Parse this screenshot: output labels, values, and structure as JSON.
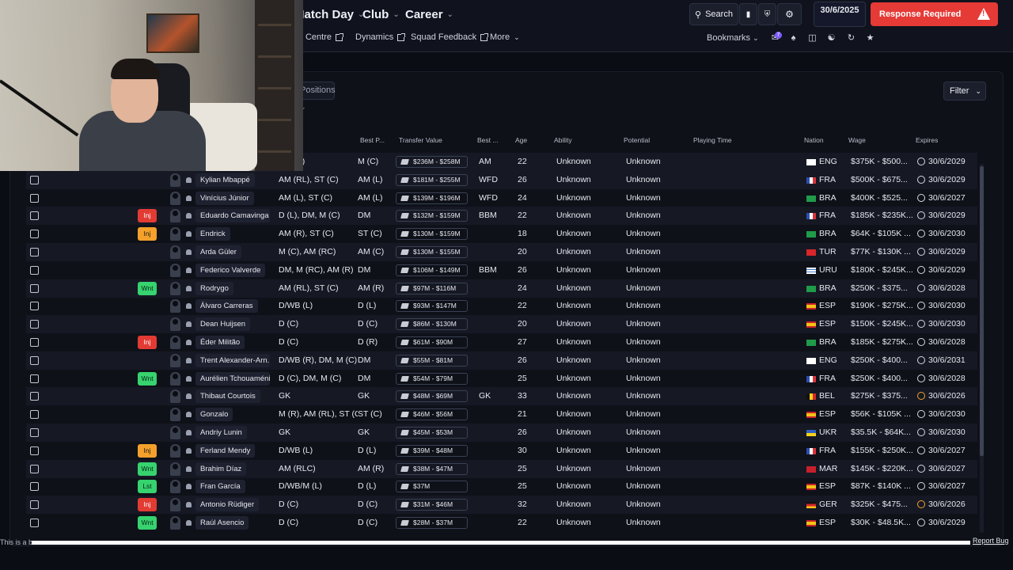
{
  "nav": {
    "main": [
      {
        "label": "Match Day"
      },
      {
        "label": "Club"
      },
      {
        "label": "Career"
      }
    ],
    "sub": [
      {
        "label": "Medical Centre"
      },
      {
        "label": "Dynamics"
      },
      {
        "label": "Squad Feedback"
      }
    ],
    "more": "More",
    "search": "Search",
    "date": "30/6/2025",
    "response": "Response Required",
    "bookmarks": "Bookmarks",
    "badge_count": "7"
  },
  "toolbar": {
    "view_label": "Positions",
    "filter": "Filter"
  },
  "table": {
    "columns": {
      "best_pos": "Best P...",
      "transfer_value": "Transfer Value",
      "best_role": "Best ...",
      "age": "Age",
      "ability": "Ability",
      "potential": "Potential",
      "playing_time": "Playing Time",
      "nation": "Nation",
      "wage": "Wage",
      "expires": "Expires"
    },
    "rows": [
      {
        "name": "",
        "position": "AM (C)",
        "best_pos": "M (C)",
        "tv": "$236M - $258M",
        "role": "AM",
        "age": "22",
        "ability": "Unknown",
        "potential": "Unknown",
        "nation": "ENG",
        "wage": "$375K - $500...",
        "expires": "30/6/2029",
        "tag": "",
        "flag": "eng",
        "clock": "normal"
      },
      {
        "name": "Kylian Mbappé",
        "position": "AM (RL), ST (C)",
        "best_pos": "AM (L)",
        "tv": "$181M - $255M",
        "role": "WFD",
        "age": "26",
        "ability": "Unknown",
        "potential": "Unknown",
        "nation": "FRA",
        "wage": "$500K - $675...",
        "expires": "30/6/2029",
        "tag": "",
        "flag": "fra",
        "clock": "normal"
      },
      {
        "name": "Vinícius Júnior",
        "position": "AM (L), ST (C)",
        "best_pos": "AM (L)",
        "tv": "$139M - $196M",
        "role": "WFD",
        "age": "24",
        "ability": "Unknown",
        "potential": "Unknown",
        "nation": "BRA",
        "wage": "$400K - $525...",
        "expires": "30/6/2027",
        "tag": "",
        "flag": "bra",
        "clock": "normal"
      },
      {
        "name": "Eduardo Camavinga",
        "position": "D (L), DM, M (C)",
        "best_pos": "DM",
        "tv": "$132M - $159M",
        "role": "BBM",
        "age": "22",
        "ability": "Unknown",
        "potential": "Unknown",
        "nation": "FRA",
        "wage": "$185K - $235K...",
        "expires": "30/6/2029",
        "tag": "Inj",
        "tagc": "inj-red",
        "flag": "fra",
        "clock": "normal"
      },
      {
        "name": "Endrick",
        "position": "AM (R), ST (C)",
        "best_pos": "ST (C)",
        "tv": "$130M - $159M",
        "role": "",
        "age": "18",
        "ability": "Unknown",
        "potential": "Unknown",
        "nation": "BRA",
        "wage": "$64K - $105K ...",
        "expires": "30/6/2030",
        "tag": "Inj",
        "tagc": "inj-amber",
        "flag": "bra",
        "clock": "normal"
      },
      {
        "name": "Arda Güler",
        "position": "M (C), AM (RC)",
        "best_pos": "AM (C)",
        "tv": "$130M - $155M",
        "role": "",
        "age": "20",
        "ability": "Unknown",
        "potential": "Unknown",
        "nation": "TUR",
        "wage": "$77K - $130K ...",
        "expires": "30/6/2029",
        "tag": "",
        "flag": "tur",
        "clock": "normal"
      },
      {
        "name": "Federico Valverde",
        "position": "DM, M (RC), AM (R)",
        "best_pos": "DM",
        "tv": "$106M - $149M",
        "role": "BBM",
        "age": "26",
        "ability": "Unknown",
        "potential": "Unknown",
        "nation": "URU",
        "wage": "$180K - $245K...",
        "expires": "30/6/2029",
        "tag": "",
        "flag": "uru",
        "clock": "normal"
      },
      {
        "name": "Rodrygo",
        "position": "AM (RL), ST (C)",
        "best_pos": "AM (R)",
        "tv": "$97M - $116M",
        "role": "",
        "age": "24",
        "ability": "Unknown",
        "potential": "Unknown",
        "nation": "BRA",
        "wage": "$250K - $375...",
        "expires": "30/6/2028",
        "tag": "Wnt",
        "tagc": "wnt",
        "flag": "bra",
        "clock": "normal"
      },
      {
        "name": "Álvaro Carreras",
        "position": "D/WB (L)",
        "best_pos": "D (L)",
        "tv": "$93M - $147M",
        "role": "",
        "age": "22",
        "ability": "Unknown",
        "potential": "Unknown",
        "nation": "ESP",
        "wage": "$190K - $275K...",
        "expires": "30/6/2030",
        "tag": "",
        "flag": "esp",
        "clock": "normal"
      },
      {
        "name": "Dean Huijsen",
        "position": "D (C)",
        "best_pos": "D (C)",
        "tv": "$86M - $130M",
        "role": "",
        "age": "20",
        "ability": "Unknown",
        "potential": "Unknown",
        "nation": "ESP",
        "wage": "$150K - $245K...",
        "expires": "30/6/2030",
        "tag": "",
        "flag": "esp",
        "clock": "normal"
      },
      {
        "name": "Éder Militão",
        "position": "D (C)",
        "best_pos": "D (R)",
        "tv": "$61M - $90M",
        "role": "",
        "age": "27",
        "ability": "Unknown",
        "potential": "Unknown",
        "nation": "BRA",
        "wage": "$185K - $275K...",
        "expires": "30/6/2028",
        "tag": "Inj",
        "tagc": "inj-red",
        "flag": "bra",
        "clock": "normal"
      },
      {
        "name": "Trent Alexander-Arn...",
        "position": "D/WB (R), DM, M (C)",
        "best_pos": "DM",
        "tv": "$55M - $81M",
        "role": "",
        "age": "26",
        "ability": "Unknown",
        "potential": "Unknown",
        "nation": "ENG",
        "wage": "$250K - $400...",
        "expires": "30/6/2031",
        "tag": "",
        "flag": "eng",
        "clock": "normal"
      },
      {
        "name": "Aurélien Tchouaméni",
        "position": "D (C), DM, M (C)",
        "best_pos": "DM",
        "tv": "$54M - $79M",
        "role": "",
        "age": "25",
        "ability": "Unknown",
        "potential": "Unknown",
        "nation": "FRA",
        "wage": "$250K - $400...",
        "expires": "30/6/2028",
        "tag": "Wnt",
        "tagc": "wnt",
        "flag": "fra",
        "clock": "normal"
      },
      {
        "name": "Thibaut Courtois",
        "position": "GK",
        "best_pos": "GK",
        "tv": "$48M - $69M",
        "role": "GK",
        "age": "33",
        "ability": "Unknown",
        "potential": "Unknown",
        "nation": "BEL",
        "wage": "$275K - $375...",
        "expires": "30/6/2026",
        "tag": "",
        "flag": "bel",
        "clock": "amber"
      },
      {
        "name": "Gonzalo",
        "position": "M (R), AM (RL), ST (C)",
        "best_pos": "ST (C)",
        "tv": "$46M - $56M",
        "role": "",
        "age": "21",
        "ability": "Unknown",
        "potential": "Unknown",
        "nation": "ESP",
        "wage": "$56K - $105K ...",
        "expires": "30/6/2030",
        "tag": "",
        "flag": "esp",
        "clock": "normal"
      },
      {
        "name": "Andriy Lunin",
        "position": "GK",
        "best_pos": "GK",
        "tv": "$45M - $53M",
        "role": "",
        "age": "26",
        "ability": "Unknown",
        "potential": "Unknown",
        "nation": "UKR",
        "wage": "$35.5K - $64K...",
        "expires": "30/6/2030",
        "tag": "",
        "flag": "ukr",
        "clock": "normal"
      },
      {
        "name": "Ferland Mendy",
        "position": "D/WB (L)",
        "best_pos": "D (L)",
        "tv": "$39M - $48M",
        "role": "",
        "age": "30",
        "ability": "Unknown",
        "potential": "Unknown",
        "nation": "FRA",
        "wage": "$155K - $250K...",
        "expires": "30/6/2027",
        "tag": "Inj",
        "tagc": "inj-amber",
        "flag": "fra",
        "clock": "normal"
      },
      {
        "name": "Brahim Díaz",
        "position": "AM (RLC)",
        "best_pos": "AM (R)",
        "tv": "$38M - $47M",
        "role": "",
        "age": "25",
        "ability": "Unknown",
        "potential": "Unknown",
        "nation": "MAR",
        "wage": "$145K - $220K...",
        "expires": "30/6/2027",
        "tag": "Wnt",
        "tagc": "wnt",
        "flag": "mar",
        "clock": "normal"
      },
      {
        "name": "Fran García",
        "position": "D/WB/M (L)",
        "best_pos": "D (L)",
        "tv": "$37M",
        "role": "",
        "age": "25",
        "ability": "Unknown",
        "potential": "Unknown",
        "nation": "ESP",
        "wage": "$87K - $140K ...",
        "expires": "30/6/2027",
        "tag": "Lst",
        "tagc": "lst",
        "flag": "esp",
        "clock": "normal"
      },
      {
        "name": "Antonio Rüdiger",
        "position": "D (C)",
        "best_pos": "D (C)",
        "tv": "$31M - $46M",
        "role": "",
        "age": "32",
        "ability": "Unknown",
        "potential": "Unknown",
        "nation": "GER",
        "wage": "$325K - $475...",
        "expires": "30/6/2026",
        "tag": "Inj",
        "tagc": "inj-red",
        "flag": "ger",
        "clock": "amber"
      },
      {
        "name": "Raúl Asencio",
        "position": "D (C)",
        "best_pos": "D (C)",
        "tv": "$28M - $37M",
        "role": "",
        "age": "22",
        "ability": "Unknown",
        "potential": "Unknown",
        "nation": "ESP",
        "wage": "$30K - $48.5K...",
        "expires": "30/6/2029",
        "tag": "Wnt",
        "tagc": "wnt",
        "flag": "esp",
        "clock": "normal"
      }
    ]
  },
  "footer": {
    "note": "This is a b",
    "report": "Report Bug"
  },
  "colors": {
    "bg": "#0b0d14",
    "danger": "#e53a36",
    "injury_amber": "#f3a12b",
    "wanted_green": "#36d36f"
  }
}
